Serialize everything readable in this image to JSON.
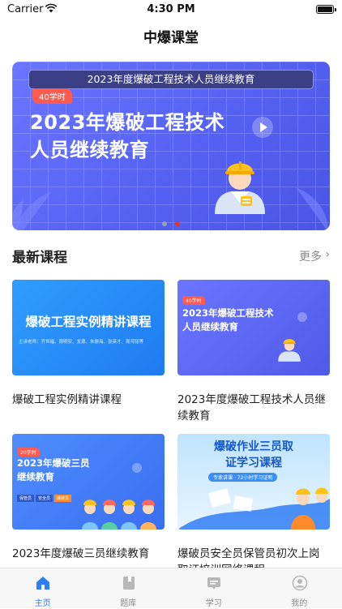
{
  "status_bar": {
    "carrier": "Carrier",
    "time": "4:30 PM"
  },
  "nav": {
    "title": "中爆课堂"
  },
  "banner": {
    "top_bar": "2023年度爆破工程技术人员继续教育",
    "hours_badge": "40学时",
    "headline_line1": "2023年爆破工程技术",
    "headline_line2": "人员继续教育",
    "slides_count": 2,
    "active_slide": 2
  },
  "section": {
    "title": "最新课程",
    "more_label": "更多"
  },
  "courses": [
    {
      "title": "爆破工程实例精讲课程",
      "thumb_heading": "爆破工程实例精讲课程",
      "thumb_sub": "主讲老师：齐世福、周明安、龙源、朱振海、张英才、周鸿铭等"
    },
    {
      "title": "2023年度爆破工程技术人员继续教育",
      "thumb_hours": "40学时",
      "thumb_line1": "2023年爆破工程技术",
      "thumb_line2": "人员继续教育"
    },
    {
      "title": "2023年度爆破三员继续教育",
      "thumb_hours": "20学时",
      "thumb_line1": "2023年爆破三员",
      "thumb_line2": "继续教育",
      "thumb_tags": [
        "保管员",
        "安全员",
        "爆破员"
      ]
    },
    {
      "title": "爆破员安全员保管员初次上岗取证培训网络课程",
      "thumb_line1": "爆破作业三员取",
      "thumb_line2": "证学习课程",
      "thumb_sub": "专家讲课 · 72小时学习证明"
    }
  ],
  "tab_bar": {
    "tabs": [
      {
        "label": "主页",
        "icon": "home-icon",
        "active": true
      },
      {
        "label": "题库",
        "icon": "book-icon",
        "active": false
      },
      {
        "label": "学习",
        "icon": "chat-icon",
        "active": false
      },
      {
        "label": "我的",
        "icon": "profile-icon",
        "active": false
      }
    ]
  },
  "colors": {
    "accent": "#2f7ef5",
    "banner_blue": "#5561f2",
    "dot_active": "#e5322d"
  }
}
